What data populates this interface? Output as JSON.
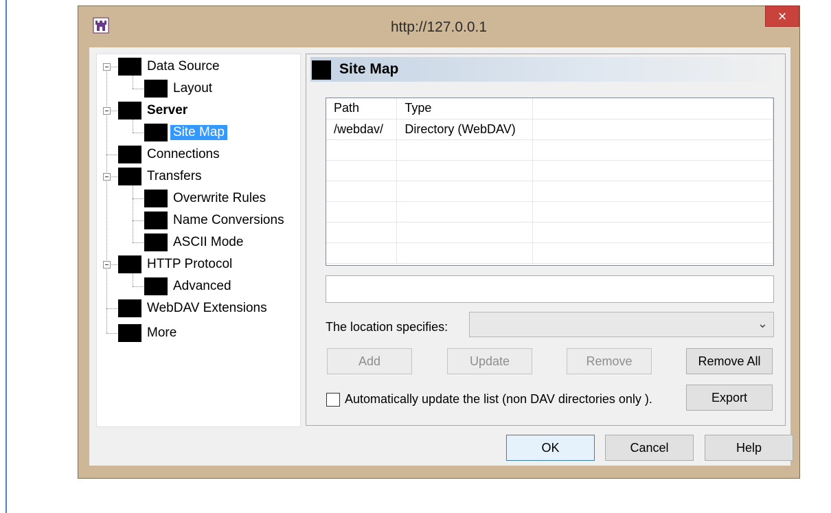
{
  "window": {
    "title": "http://127.0.0.1",
    "close_label": "×",
    "frame_color": "#cdb796",
    "close_color": "#c9423b"
  },
  "tree": {
    "items": [
      {
        "label": "Data Source"
      },
      {
        "label": "Layout"
      },
      {
        "label": "Server"
      },
      {
        "label": "Site Map"
      },
      {
        "label": "Connections"
      },
      {
        "label": "Transfers"
      },
      {
        "label": "Overwrite Rules"
      },
      {
        "label": "Name Conversions"
      },
      {
        "label": "ASCII Mode"
      },
      {
        "label": "HTTP Protocol"
      },
      {
        "label": "Advanced"
      },
      {
        "label": "WebDAV Extensions"
      },
      {
        "label": "More"
      }
    ],
    "selected": "Site Map",
    "selection_color": "#3399ff"
  },
  "panel": {
    "title": "Site Map",
    "columns": [
      "Path",
      "Type"
    ],
    "rows": [
      [
        "/webdav/",
        "Directory (WebDAV)"
      ]
    ],
    "path_input_value": "",
    "location_label": "The location specifies:",
    "location_value": "",
    "buttons": {
      "add": "Add",
      "update": "Update",
      "remove": "Remove",
      "remove_all": "Remove All",
      "export": "Export"
    },
    "auto_update_label": "Automatically update the list (non DAV directories only ).",
    "auto_update_checked": false
  },
  "footer": {
    "ok": "OK",
    "cancel": "Cancel",
    "help": "Help"
  }
}
